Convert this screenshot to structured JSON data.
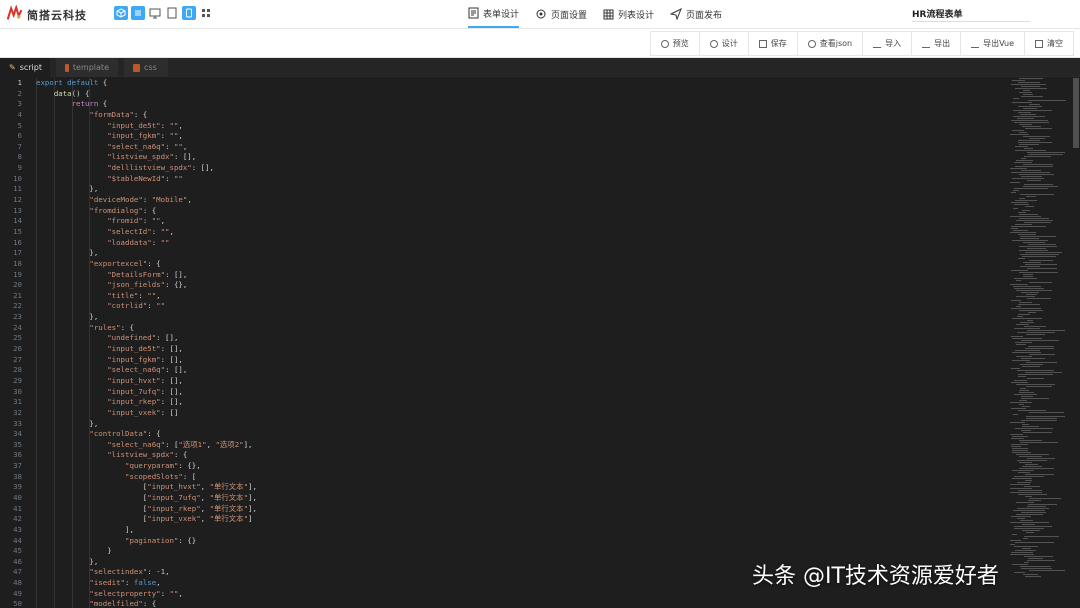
{
  "header": {
    "brand": "简搭云科技",
    "nav": [
      {
        "label": "表单设计",
        "icon": "form-icon",
        "active": true
      },
      {
        "label": "页面设置",
        "icon": "gear-icon",
        "active": false
      },
      {
        "label": "列表设计",
        "icon": "grid-icon",
        "active": false
      },
      {
        "label": "页面发布",
        "icon": "send-icon",
        "active": false
      }
    ],
    "form_name": "HR流程表单"
  },
  "toolbar": {
    "buttons": [
      "预览",
      "设计",
      "保存",
      "查看json",
      "导入",
      "导出",
      "导出Vue",
      "清空"
    ]
  },
  "editor": {
    "tabs": [
      "script",
      "template",
      "css"
    ],
    "active_tab": "script",
    "lines": [
      "export default {",
      "    data() {",
      "        return {",
      "            \"formData\": {",
      "                \"input_de5t\": \"\",",
      "                \"input_fgkm\": \"\",",
      "                \"select_na6q\": \"\",",
      "                \"listview_spdx\": [],",
      "                \"delllistview_spdx\": [],",
      "                \"$tableNewId\": \"\"",
      "            },",
      "            \"deviceMode\": \"Mobile\",",
      "            \"fromdialog\": {",
      "                \"fromid\": \"\",",
      "                \"selectId\": \"\",",
      "                \"loaddata\": \"\"",
      "            },",
      "            \"exportexcel\": {",
      "                \"DetailsForm\": [],",
      "                \"json_fields\": {},",
      "                \"title\": \"\",",
      "                \"cotrlid\": \"\"",
      "            },",
      "            \"rules\": {",
      "                \"undefined\": [],",
      "                \"input_de5t\": [],",
      "                \"input_fgkm\": [],",
      "                \"select_na6q\": [],",
      "                \"input_hvxt\": [],",
      "                \"input_7ufq\": [],",
      "                \"input_rkep\": [],",
      "                \"input_vxek\": []",
      "            },",
      "            \"controlData\": {",
      "                \"select_na6q\": [\"选项1\", \"选项2\"],",
      "                \"listview_spdx\": {",
      "                    \"queryparam\": {},",
      "                    \"scopedSlots\": [",
      "                        [\"input_hvxt\", \"单行文本\"],",
      "                        [\"input_7ufq\", \"单行文本\"],",
      "                        [\"input_rkep\", \"单行文本\"],",
      "                        [\"input_vxek\", \"单行文本\"]",
      "                    ],",
      "                    \"pagination\": {}",
      "                }",
      "            },",
      "            \"selectindex\": -1,",
      "            \"isedit\": false,",
      "            \"selectproperty\": \"\",",
      "            \"modelfiled\": {"
    ]
  },
  "watermark": "头条 @IT技术资源爱好者"
}
